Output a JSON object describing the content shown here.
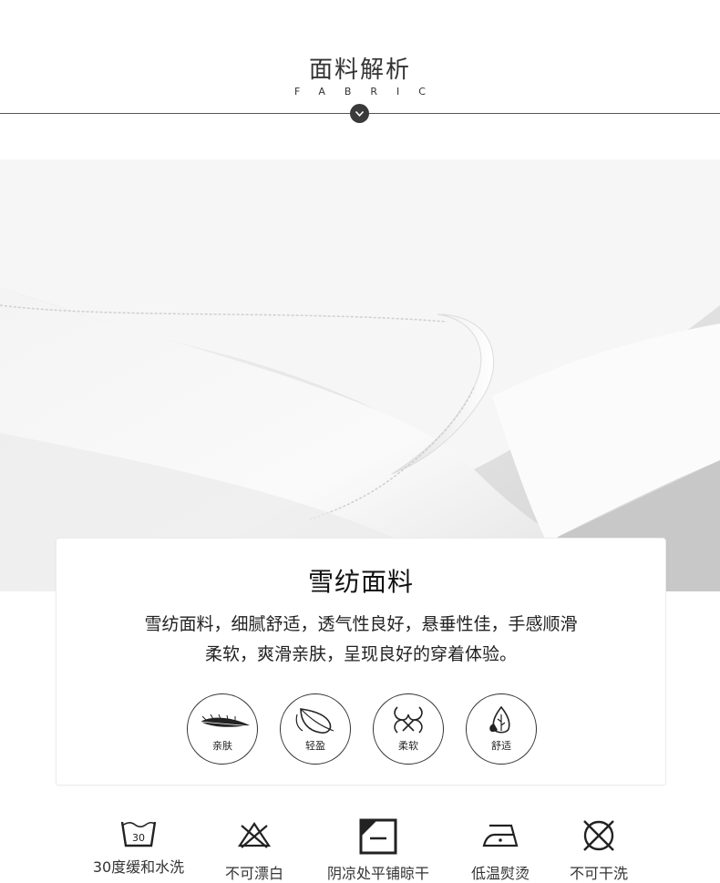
{
  "header": {
    "title": "面料解析",
    "subtitle": "FABRIC"
  },
  "card": {
    "title": "雪纺面料",
    "description_line1": "雪纺面料，细腻舒适，透气性良好，悬垂性佳，手感顺滑",
    "description_line2": "柔软，爽滑亲肤，呈现良好的穿着体验。",
    "features": [
      {
        "label": "亲肤",
        "icon": "feather-icon"
      },
      {
        "label": "轻盈",
        "icon": "leaf-icon"
      },
      {
        "label": "柔软",
        "icon": "knot-icon"
      },
      {
        "label": "舒适",
        "icon": "drop-leaf-icon"
      }
    ]
  },
  "care": [
    {
      "label": "30度缓和水洗",
      "icon": "wash-30-icon",
      "temp": "30"
    },
    {
      "label": "不可漂白",
      "icon": "no-bleach-icon"
    },
    {
      "label": "阴凉处平铺晾干",
      "icon": "flat-dry-shade-icon"
    },
    {
      "label": "低温熨烫",
      "icon": "iron-low-icon"
    },
    {
      "label": "不可干洗",
      "icon": "no-dry-clean-icon"
    }
  ],
  "colors": {
    "accent": "#3a3a3a",
    "line": "#555555"
  }
}
